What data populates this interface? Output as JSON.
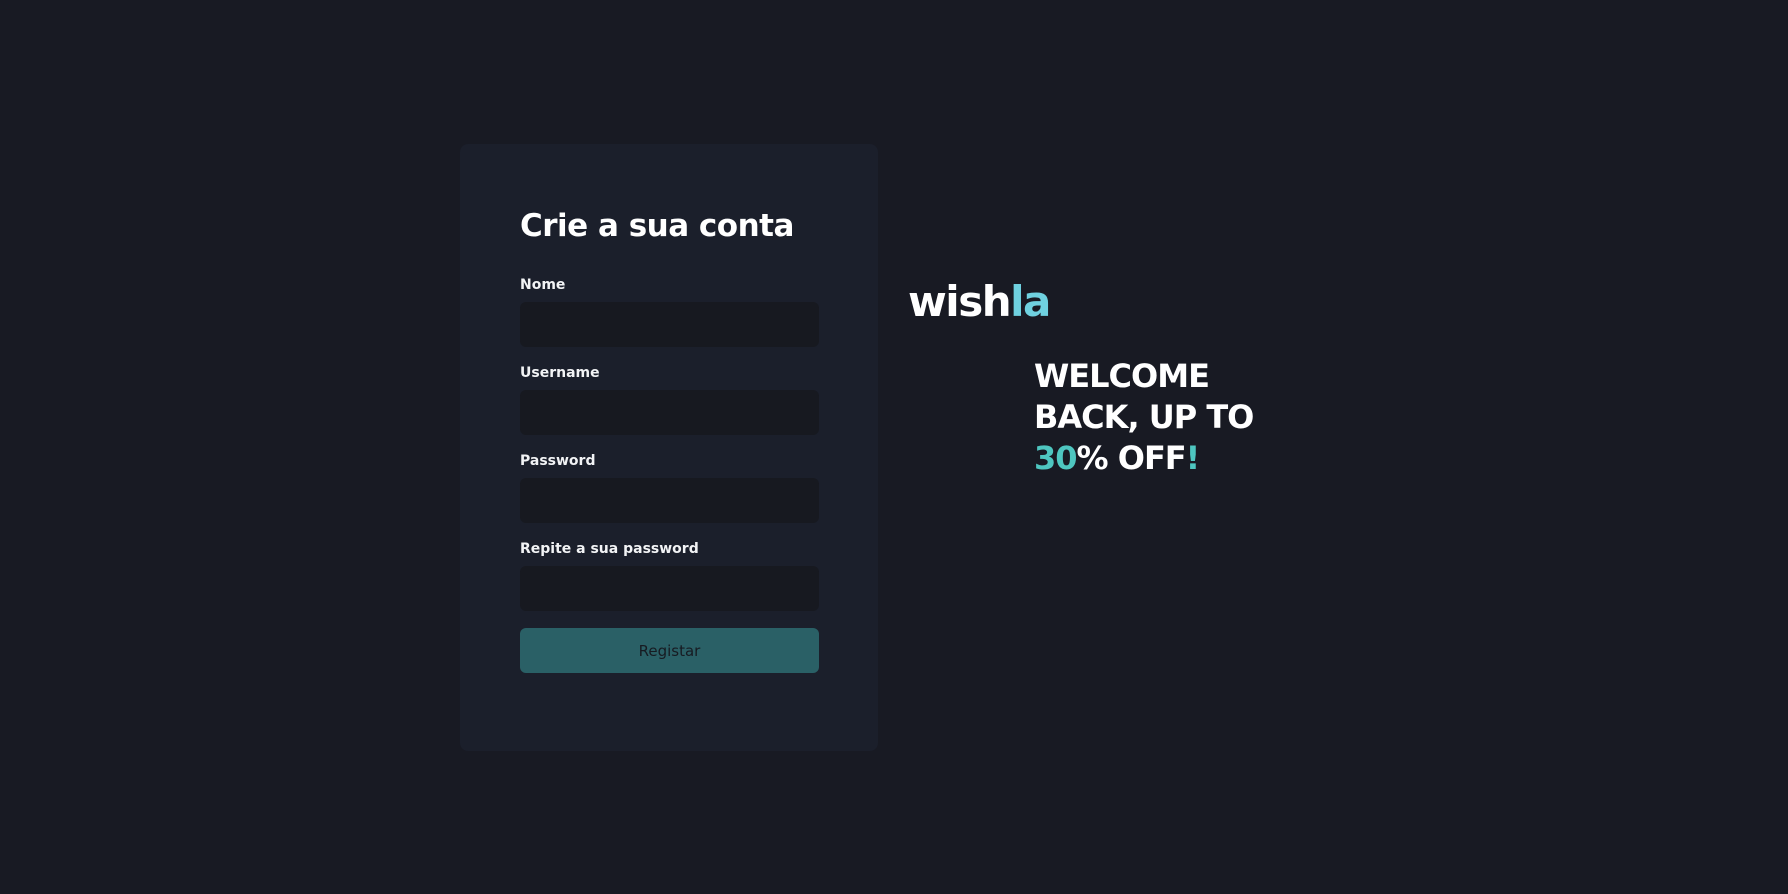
{
  "form": {
    "title": "Crie a sua conta",
    "fields": [
      {
        "label": "Nome",
        "value": "",
        "placeholder": ""
      },
      {
        "label": "Username",
        "value": "",
        "placeholder": ""
      },
      {
        "label": "Password",
        "value": "",
        "placeholder": ""
      },
      {
        "label": "Repite a sua password",
        "value": "",
        "placeholder": ""
      }
    ],
    "submit_label": "Registar"
  },
  "brand": {
    "logo_main": "wish",
    "logo_accent": "la"
  },
  "promo": {
    "line1": "WELCOME",
    "line2": "BACK, UP TO",
    "percent": "30",
    "suffix": "% OFF",
    "exclaim": "!"
  },
  "colors": {
    "background": "#181a23",
    "card": "#1b1f2b",
    "input": "#171920",
    "button": "#2a6066",
    "logo_accent": "#6fd1e0",
    "promo_accent": "#4ec6c0"
  }
}
